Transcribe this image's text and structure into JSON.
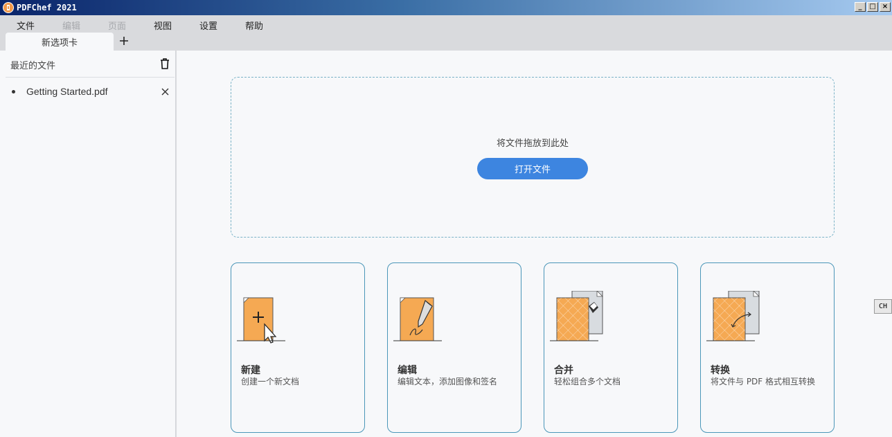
{
  "window": {
    "title": "PDFChef 2021"
  },
  "menu": [
    {
      "label": "文件",
      "enabled": true
    },
    {
      "label": "编辑",
      "enabled": false
    },
    {
      "label": "页面",
      "enabled": false
    },
    {
      "label": "视图",
      "enabled": true
    },
    {
      "label": "设置",
      "enabled": true
    },
    {
      "label": "帮助",
      "enabled": true
    }
  ],
  "tabs": [
    {
      "label": "新选项卡",
      "active": true
    }
  ],
  "sidebar": {
    "header": "最近的文件",
    "recent": [
      {
        "name": "Getting Started.pdf"
      }
    ]
  },
  "dropzone": {
    "text": "将文件拖放到此处",
    "button": "打开文件"
  },
  "cards": [
    {
      "title": "新建",
      "desc": "创建一个新文档",
      "icon": "new-document-icon"
    },
    {
      "title": "编辑",
      "desc": "编辑文本，添加图像和签名",
      "icon": "edit-document-icon"
    },
    {
      "title": "合并",
      "desc": "轻松组合多个文档",
      "icon": "merge-documents-icon"
    },
    {
      "title": "转换",
      "desc": "将文件与 PDF 格式相互转换",
      "icon": "convert-document-icon"
    }
  ],
  "ime": {
    "label": "CH"
  },
  "colors": {
    "accent": "#3d85e0",
    "card_border": "#4a96b8",
    "doc_orange": "#f5a953"
  }
}
